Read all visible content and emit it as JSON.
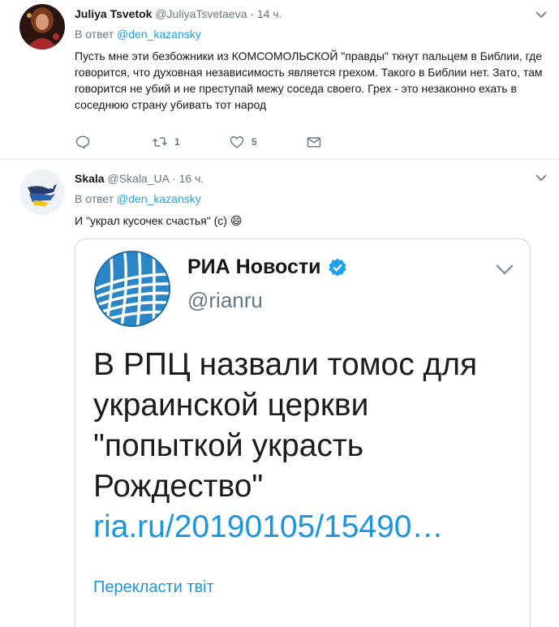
{
  "tweets": [
    {
      "name": "Juliya Tsvetok",
      "handle": "@JuliyaTsvetaeva",
      "dot": "·",
      "time": "14 ч.",
      "reply_prefix": "В ответ",
      "reply_to": "@den_kazansky",
      "text": "Пусть мне эти безбожники из КОМСОМОЛЬСКОЙ \"правды\" ткнут пальцем в Библии, где говорится, что духовная независимость является грехом. Такого в Библии нет. Зато, там говорится не убий и не преступай межу соседа своего. Грех - это незаконно ехать в соседнюю страну убивать тот народ",
      "retweets": "1",
      "likes": "5"
    },
    {
      "name": "Skala",
      "handle": "@Skala_UA",
      "dot": "·",
      "time": "16 ч.",
      "reply_prefix": "В ответ",
      "reply_to": "@den_kazansky",
      "text": "И \"украл кусочек счастья\" (с) 😄"
    }
  ],
  "embedded_card": {
    "name": "РИА Новости",
    "handle": "@rianru",
    "headline": "В РПЦ назвали томос для украинской церкви \"попыткой украсть Рождество\"",
    "link": "ria.ru/20190105/15490…",
    "translate_label": "Перекласти твіт"
  },
  "colors": {
    "accent": "#1da1f2",
    "secondary_text": "#657786",
    "divider": "#e6ecf0"
  },
  "icons": [
    "reply-icon",
    "retweet-icon",
    "like-icon",
    "direct-message-icon",
    "chevron-down-icon",
    "verified-badge-icon"
  ]
}
